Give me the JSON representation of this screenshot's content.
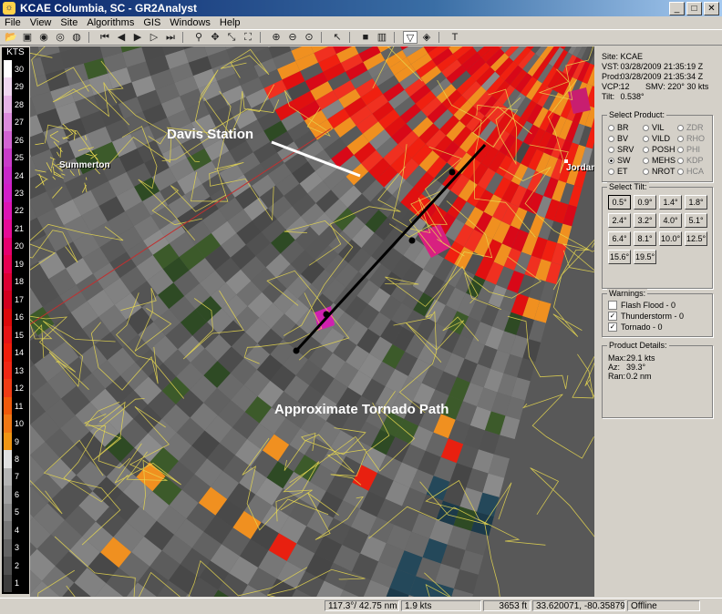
{
  "window": {
    "title": "KCAE Columbia, SC - GR2Analyst",
    "controls": [
      "_",
      "□",
      "✕"
    ]
  },
  "menu": [
    "File",
    "View",
    "Site",
    "Algorithms",
    "GIS",
    "Windows",
    "Help"
  ],
  "toolbar_icons": [
    "open-folder-icon",
    "save-icon",
    "globe-icon",
    "globe-2-icon",
    "globe-3-icon",
    "sep",
    "first-frame-icon",
    "prev-frame-icon",
    "play-icon",
    "next-frame-icon",
    "last-frame-icon",
    "sep",
    "zoom-icon",
    "pan-icon",
    "resize-icon",
    "fullscreen-icon",
    "sep",
    "zoom-in-icon",
    "zoom-out-icon",
    "zoom-reset-icon",
    "sep",
    "pointer-icon",
    "sep",
    "stop-icon",
    "split-icon",
    "sep",
    "cross-section-icon",
    "volume-icon",
    "sep",
    "text-tool-icon"
  ],
  "legend": {
    "unit": "KTS",
    "ticks": [
      "30",
      "29",
      "28",
      "27",
      "26",
      "25",
      "24",
      "23",
      "22",
      "21",
      "20",
      "19",
      "18",
      "17",
      "16",
      "15",
      "14",
      "13",
      "12",
      "11",
      "10",
      "9",
      "8",
      "7",
      "6",
      "5",
      "4",
      "3",
      "2",
      "1"
    ],
    "colors": [
      "#ffffff",
      "#f0d8f0",
      "#e6b4e6",
      "#dc8cdc",
      "#d264d2",
      "#c83cc8",
      "#c828c8",
      "#d21ec8",
      "#dc14b4",
      "#e60a96",
      "#e6006e",
      "#e60050",
      "#dc0032",
      "#d2001e",
      "#dc0a0a",
      "#e61414",
      "#f01e0a",
      "#f02814",
      "#f03c14",
      "#f05a0a",
      "#f07814",
      "#f09614",
      "#e0e0e0",
      "#b4b4b4",
      "#a0a0a0",
      "#8c8c8c",
      "#787878",
      "#646464",
      "#505050",
      "#3c3c3c"
    ]
  },
  "map": {
    "towns": [
      {
        "name": "Summerton"
      },
      {
        "name": "Jordan"
      }
    ],
    "annotations": {
      "station": "Davis Station",
      "path": "Approximate Tornado Path"
    }
  },
  "info": {
    "site_label": "Site:",
    "site": "KCAE",
    "vst_label": "VST:",
    "vst": "03/28/2009 21:35:19 Z",
    "prod_label": "Prod:",
    "prod": "03/28/2009 21:35:34 Z",
    "vcp_label": "VCP:",
    "vcp": "12",
    "smv": "SMV: 220° 30 kts",
    "tilt_label": "Tilt:",
    "tilt": "0.538°"
  },
  "select_product": {
    "title": "Select Product:",
    "options": [
      {
        "label": "BR",
        "selected": false,
        "disabled": false
      },
      {
        "label": "VIL",
        "selected": false,
        "disabled": false
      },
      {
        "label": "ZDR",
        "selected": false,
        "disabled": true
      },
      {
        "label": "BV",
        "selected": false,
        "disabled": false
      },
      {
        "label": "VILD",
        "selected": false,
        "disabled": false
      },
      {
        "label": "RHO",
        "selected": false,
        "disabled": true
      },
      {
        "label": "SRV",
        "selected": false,
        "disabled": false
      },
      {
        "label": "POSH",
        "selected": false,
        "disabled": false
      },
      {
        "label": "PHI",
        "selected": false,
        "disabled": true
      },
      {
        "label": "SW",
        "selected": true,
        "disabled": false
      },
      {
        "label": "MEHS",
        "selected": false,
        "disabled": false
      },
      {
        "label": "KDP",
        "selected": false,
        "disabled": true
      },
      {
        "label": "ET",
        "selected": false,
        "disabled": false
      },
      {
        "label": "NROT",
        "selected": false,
        "disabled": false
      },
      {
        "label": "HCA",
        "selected": false,
        "disabled": true
      }
    ]
  },
  "select_tilt": {
    "title": "Select Tilt:",
    "buttons": [
      "0.5°",
      "0.9°",
      "1.4°",
      "1.8°",
      "2.4°",
      "3.2°",
      "4.0°",
      "5.1°",
      "6.4°",
      "8.1°",
      "10.0°",
      "12.5°",
      "15.6°",
      "19.5°"
    ],
    "selected": "0.5°"
  },
  "warnings": {
    "title": "Warnings:",
    "items": [
      {
        "label": "Flash Flood - 0",
        "checked": false
      },
      {
        "label": "Thunderstorm - 0",
        "checked": true
      },
      {
        "label": "Tornado - 0",
        "checked": true
      }
    ]
  },
  "product_details": {
    "title": "Product Details:",
    "max_label": "Max:",
    "max": "29.1 kts",
    "az_label": "Az:",
    "az": "39.3°",
    "ran_label": "Ran:",
    "ran": "0.2 nm"
  },
  "status": {
    "position": "117.3°/ 42.75 nm",
    "value": "1.9 kts",
    "height": "3653 ft",
    "latlon": "33.620071, -80.358795",
    "mode": "Offline"
  }
}
